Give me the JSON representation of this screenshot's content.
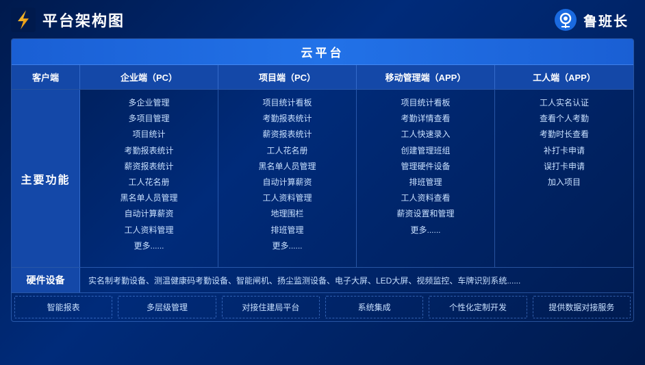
{
  "header": {
    "title": "平台架构图",
    "brand": "鲁班长"
  },
  "cloud_label": "云平台",
  "columns": {
    "client": "客户端",
    "enterprise": "企业端（PC）",
    "project": "项目端（PC）",
    "mobile": "移动管理端（APP）",
    "worker": "工人端（APP）"
  },
  "main_label": "主要功能",
  "features": {
    "enterprise": [
      "多企业管理",
      "多项目管理",
      "项目统计",
      "考勤报表统计",
      "薪资报表统计",
      "工人花名册",
      "黑名单人员管理",
      "自动计算薪资",
      "工人资料管理",
      "更多......"
    ],
    "project": [
      "项目统计看板",
      "考勤报表统计",
      "薪资报表统计",
      "工人花名册",
      "黑名单人员管理",
      "自动计算薪资",
      "工人资料管理",
      "地理围栏",
      "排班管理",
      "更多......"
    ],
    "mobile": [
      "项目统计看板",
      "考勤详情查看",
      "工人快速录入",
      "创建管理班组",
      "管理硬件设备",
      "排班管理",
      "工人资料查看",
      "薪资设置和管理",
      "更多......"
    ],
    "worker": [
      "工人实名认证",
      "查看个人考勤",
      "考勤时长查看",
      "补打卡申请",
      "误打卡申请",
      "加入项目"
    ]
  },
  "hardware": {
    "label": "硬件设备",
    "content": "实名制考勤设备、测温健康码考勤设备、智能闸机、扬尘监测设备、电子大屏、LED大屏、视频监控、车牌识别系统......"
  },
  "tags": [
    "智能报表",
    "多层级管理",
    "对接住建局平台",
    "系统集成",
    "个性化定制开发",
    "提供数据对接服务"
  ]
}
